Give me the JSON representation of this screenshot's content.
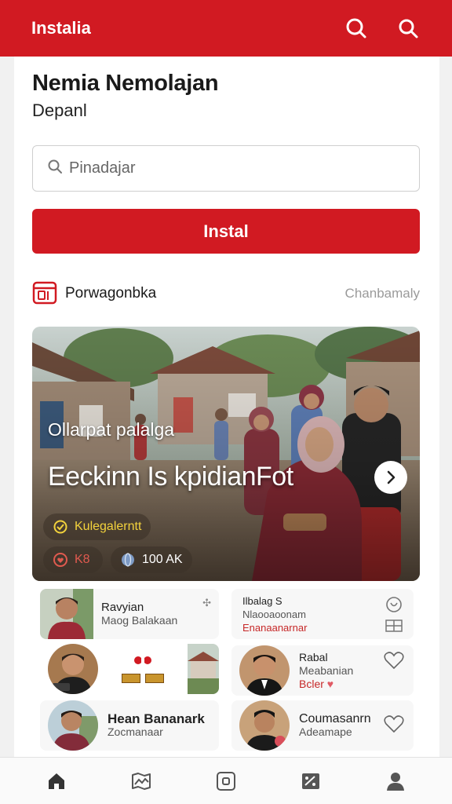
{
  "app": {
    "title": "Instalia"
  },
  "colors": {
    "brand": "#d11a22",
    "accent_yellow": "#f2d23c"
  },
  "header": {
    "icons": [
      "search-icon",
      "search-icon"
    ]
  },
  "page": {
    "heading": "Nemia Nemolajan",
    "subheading": "Depanl"
  },
  "search": {
    "placeholder": "Pinadajar"
  },
  "install_button": {
    "label": "Instal"
  },
  "section": {
    "label": "Porwagonbka",
    "link": "Chanbamaly"
  },
  "hero": {
    "kicker": "Ollarpat palalga",
    "headline": "Eeckinn Is kpidianFot",
    "category": "Kulegalerntt",
    "stat1": "K8",
    "stat2": "100 AK"
  },
  "cards": [
    {
      "name": "Ravyian",
      "meta": "Maog Balakaan"
    },
    {
      "name": "Ilbalag S",
      "meta": "Nlaooaoonam",
      "meta2": "Enanaanarnar"
    },
    {
      "name": "",
      "meta": ""
    },
    {
      "name": "Rabal",
      "meta": "Meabanian",
      "meta2": "Bcler"
    },
    {
      "name": "Hean Bananark",
      "meta": "Zocmanaar"
    },
    {
      "name": "Coumasanrn",
      "meta": "Adeamape"
    }
  ],
  "bottom_nav": [
    "home-icon",
    "map-icon",
    "square-icon",
    "image-icon",
    "profile-icon"
  ]
}
